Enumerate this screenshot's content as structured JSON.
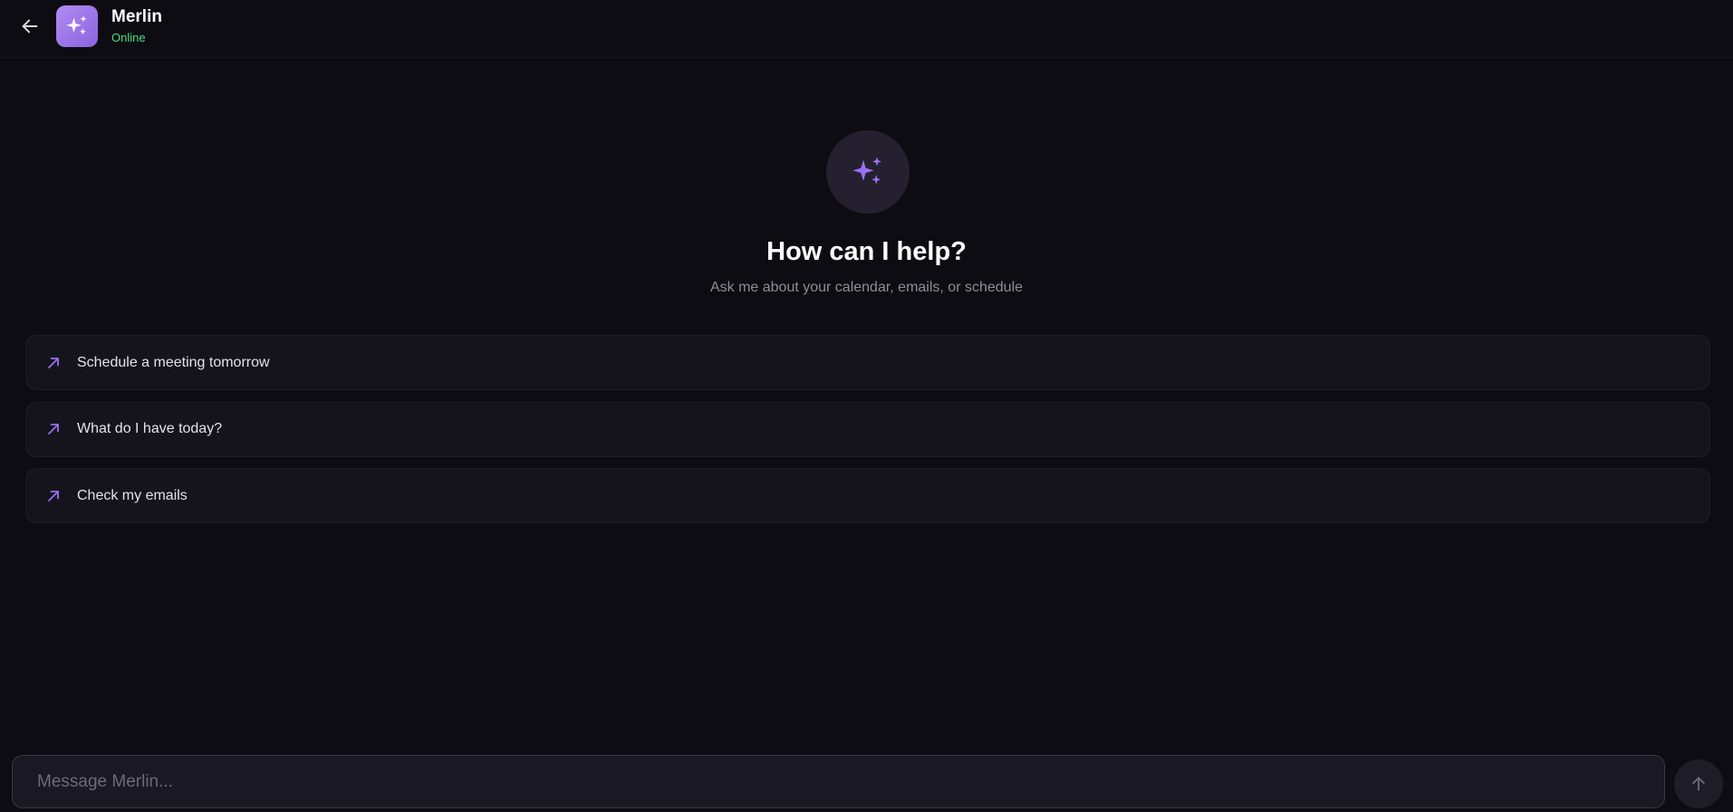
{
  "header": {
    "back_icon": "arrow-left-icon",
    "app_icon": "sparkles-icon",
    "title": "Merlin",
    "status": "Online",
    "status_color": "#4ade80"
  },
  "hero": {
    "icon": "sparkles-icon",
    "title": "How can I help?",
    "subtitle": "Ask me about your calendar, emails, or schedule"
  },
  "suggestions": [
    {
      "icon": "arrow-up-right-icon",
      "label": "Schedule a meeting tomorrow"
    },
    {
      "icon": "arrow-up-right-icon",
      "label": "What do I have today?"
    },
    {
      "icon": "arrow-up-right-icon",
      "label": "Check my emails"
    }
  ],
  "composer": {
    "placeholder": "Message Merlin...",
    "value": "",
    "send_icon": "arrow-up-icon"
  },
  "colors": {
    "background": "#0d0c12",
    "accent": "#9b6ff0",
    "card": "#15141d"
  }
}
